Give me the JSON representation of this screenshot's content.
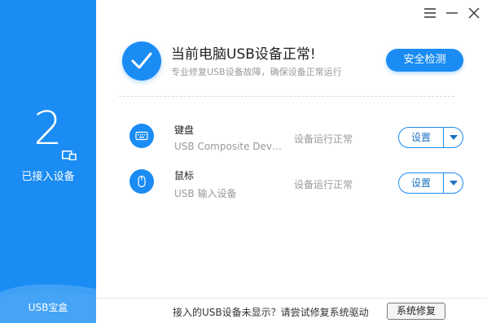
{
  "sidebar": {
    "device_count": "2",
    "count_label": "已接入设备",
    "brand": "USB宝盒",
    "device_icon": "devices-icon"
  },
  "window_controls": {
    "menu_icon": "menu-icon",
    "minimize_icon": "minimize-icon",
    "close_icon": "close-icon"
  },
  "header": {
    "status_title": "当前电脑USB设备正常!",
    "status_subtitle": "专业修复USB设备故障，确保设备正常运行",
    "scan_button": "安全检测",
    "status_icon": "check-icon"
  },
  "devices": [
    {
      "name": "键盘",
      "description": "USB Composite Devi...",
      "status": "设备运行正常",
      "settings_label": "设置",
      "icon": "keyboard-icon"
    },
    {
      "name": "鼠标",
      "description": "USB 输入设备",
      "status": "设备运行正常",
      "settings_label": "设置",
      "icon": "mouse-icon"
    }
  ],
  "footer": {
    "hint": "接入的USB设备未显示？请尝试修复系统驱动",
    "repair_button": "系统修复"
  },
  "colors": {
    "primary": "#1a8cf3",
    "sidebar_wave": "#5fb2f7"
  }
}
